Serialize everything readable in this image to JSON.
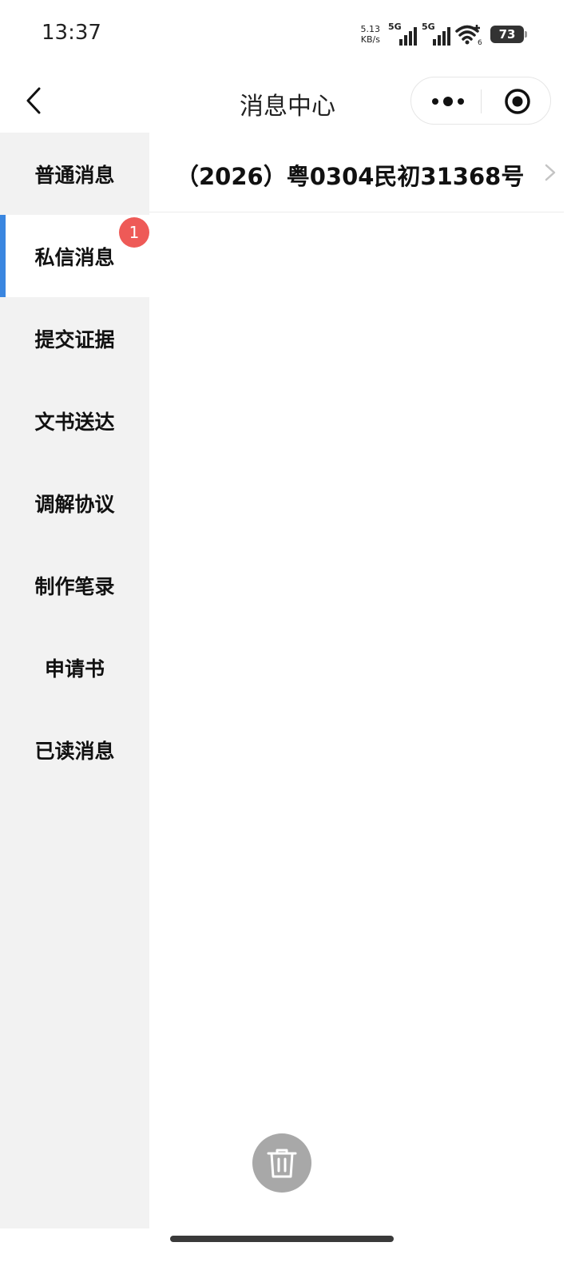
{
  "status_bar": {
    "time": "13:37",
    "net_speed_value": "5.13",
    "net_speed_unit": "KB/s",
    "sim1_label": "5G",
    "sim2_label": "5G",
    "wifi_badge": "6",
    "battery": "73"
  },
  "navbar": {
    "back_icon": "chevron-left-icon",
    "title": "消息中心",
    "capsule_more_icon": "more-dots-icon",
    "capsule_close_icon": "target-close-icon"
  },
  "sidebar": {
    "items": [
      {
        "label": "普通消息"
      },
      {
        "label": "私信消息",
        "badge": "1"
      },
      {
        "label": "提交证据"
      },
      {
        "label": "文书送达"
      },
      {
        "label": "调解协议"
      },
      {
        "label": "制作笔录"
      },
      {
        "label": "申请书"
      },
      {
        "label": "已读消息"
      }
    ],
    "active_index": 1
  },
  "main": {
    "case_title": "（2026）粤0304民初31368号",
    "chevron_icon": "chevron-right-icon",
    "delete_icon": "trash-icon"
  },
  "colors": {
    "accent": "#3a86e0",
    "badge": "#ee5a57",
    "sidebar_bg": "#f2f2f2",
    "fab_bg": "#a8a8a8"
  }
}
